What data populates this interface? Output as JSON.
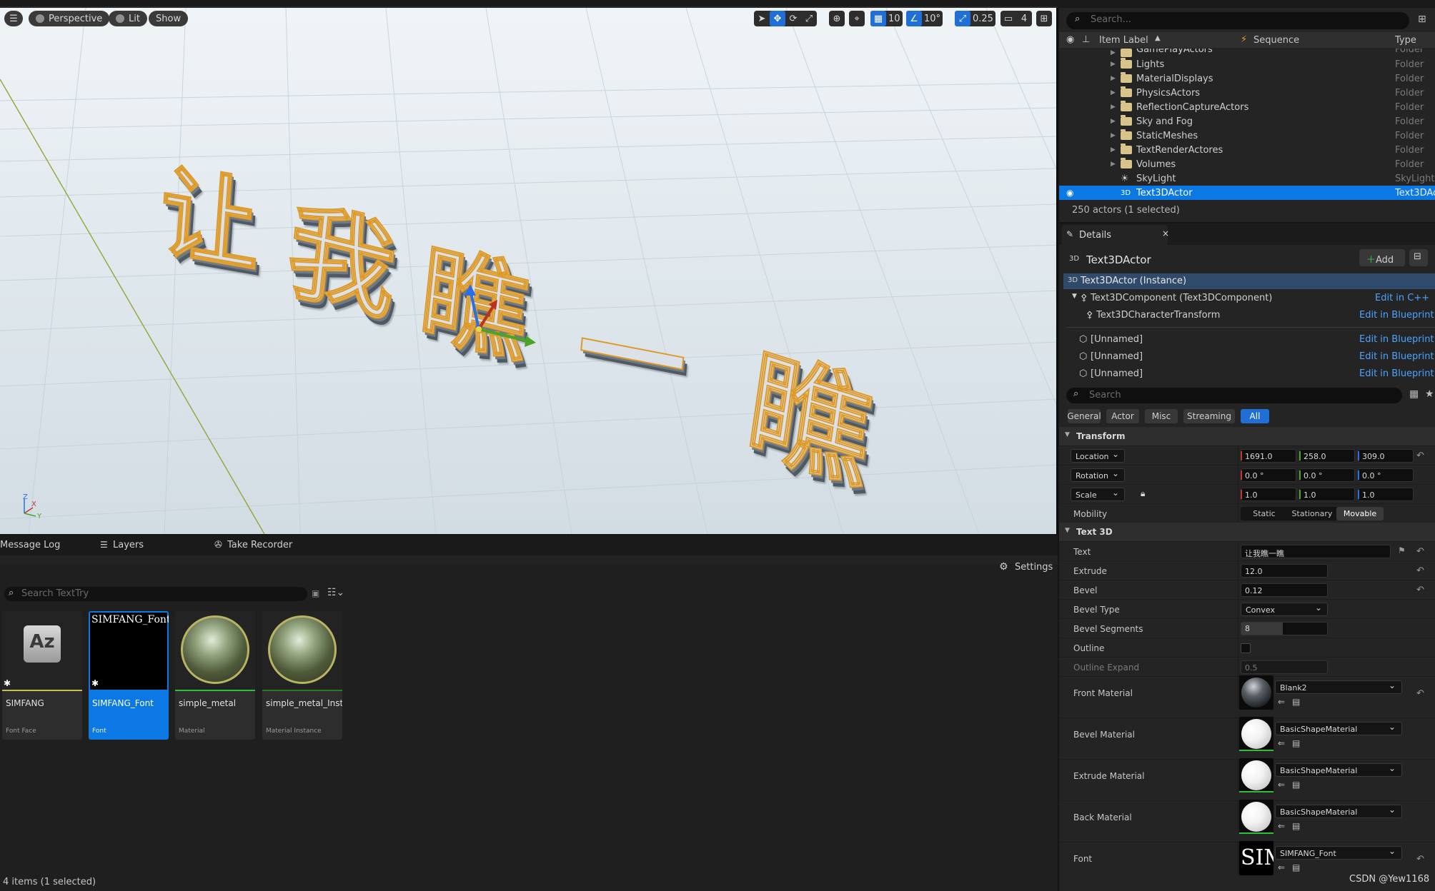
{
  "viewport": {
    "menu_icon": "hamburger-icon",
    "perspective_label": "Perspective",
    "lit_label": "Lit",
    "show_label": "Show",
    "grid_snap_value": "10",
    "rotation_snap_value": "10°",
    "scale_snap_value": "0.25",
    "camera_speed_value": "4",
    "scene_text_chars": [
      "让",
      "我",
      "瞧",
      "一",
      "瞧"
    ],
    "axis_labels": {
      "z": "Z",
      "x": "X",
      "y": "Y"
    }
  },
  "outliner": {
    "search_placeholder": "Search...",
    "columns": {
      "label": "Item Label",
      "sequence": "Sequence",
      "type": "Type"
    },
    "rows": [
      {
        "label": "GamePlayActors",
        "type": "Folder",
        "kind": "folder"
      },
      {
        "label": "Lights",
        "type": "Folder",
        "kind": "folder"
      },
      {
        "label": "MaterialDisplays",
        "type": "Folder",
        "kind": "folder"
      },
      {
        "label": "PhysicsActors",
        "type": "Folder",
        "kind": "folder"
      },
      {
        "label": "ReflectionCaptureActors",
        "type": "Folder",
        "kind": "folder"
      },
      {
        "label": "Sky and Fog",
        "type": "Folder",
        "kind": "folder"
      },
      {
        "label": "StaticMeshes",
        "type": "Folder",
        "kind": "folder"
      },
      {
        "label": "TextRenderActores",
        "type": "Folder",
        "kind": "folder"
      },
      {
        "label": "Volumes",
        "type": "Folder",
        "kind": "folder"
      },
      {
        "label": "SkyLight",
        "type": "SkyLight",
        "kind": "skylight"
      },
      {
        "label": "Text3DActor",
        "type": "Text3DAc",
        "kind": "text3d",
        "selected": true
      }
    ],
    "footer": "250 actors (1 selected)"
  },
  "details": {
    "tab_label": "Details",
    "actor_name": "Text3DActor",
    "add_label": "Add",
    "components": [
      {
        "label": "Text3DActor (Instance)",
        "link": ""
      },
      {
        "label": "Text3DComponent (Text3DComponent)",
        "link": "Edit in C++"
      },
      {
        "label": "Text3DCharacterTransform",
        "link": "Edit in Blueprint"
      },
      {
        "label": "[Unnamed]",
        "link": "Edit in Blueprint"
      },
      {
        "label": "[Unnamed]",
        "link": "Edit in Blueprint"
      },
      {
        "label": "[Unnamed]",
        "link": "Edit in Blueprint"
      }
    ],
    "search_placeholder": "Search",
    "filters": [
      "General",
      "Actor",
      "Misc",
      "Streaming",
      "All"
    ],
    "active_filter": "All",
    "transform": {
      "title": "Transform",
      "location_label": "Location",
      "location": [
        "1691.0",
        "258.0",
        "309.0"
      ],
      "rotation_label": "Rotation",
      "rotation": [
        "0.0 °",
        "0.0 °",
        "0.0 °"
      ],
      "scale_label": "Scale",
      "scale": [
        "1.0",
        "1.0",
        "1.0"
      ],
      "mobility_label": "Mobility",
      "mobility_options": [
        "Static",
        "Stationary",
        "Movable"
      ],
      "mobility_selected": "Movable"
    },
    "text3d": {
      "title": "Text 3D",
      "text_label": "Text",
      "text_value": "让我瞧一瞧",
      "extrude_label": "Extrude",
      "extrude_value": "12.0",
      "bevel_label": "Bevel",
      "bevel_value": "0.12",
      "bevel_type_label": "Bevel Type",
      "bevel_type_value": "Convex",
      "bevel_segments_label": "Bevel Segments",
      "bevel_segments_value": "8",
      "outline_label": "Outline",
      "outline_expand_label": "Outline Expand",
      "outline_expand_value": "0.5",
      "front_material_label": "Front Material",
      "front_material_value": "Blank2",
      "bevel_material_label": "Bevel Material",
      "bevel_material_value": "BasicShapeMaterial",
      "extrude_material_label": "Extrude Material",
      "extrude_material_value": "BasicShapeMaterial",
      "back_material_label": "Back Material",
      "back_material_value": "BasicShapeMaterial",
      "font_label": "Font",
      "font_value": "SIMFANG_Font",
      "font_thumb_text": "SIM"
    }
  },
  "bottom": {
    "tabs": [
      "Message Log",
      "Layers",
      "Take Recorder"
    ],
    "settings_label": "Settings",
    "search_placeholder": "Search TextTry",
    "assets": [
      {
        "name": "SIMFANG",
        "type": "Font Face",
        "thumb": "Az"
      },
      {
        "name": "SIMFANG_Font",
        "type": "Font",
        "thumb": "SIMFANG_Font",
        "selected": true
      },
      {
        "name": "simple_metal",
        "type": "Material"
      },
      {
        "name": "simple_metal_Inst",
        "type": "Material Instance"
      }
    ],
    "status": "4 items (1 selected)"
  },
  "watermark": "CSDN @Yew1168",
  "colors": {
    "accent": "#0b78e3",
    "selection_outline": "#dd9a28"
  }
}
